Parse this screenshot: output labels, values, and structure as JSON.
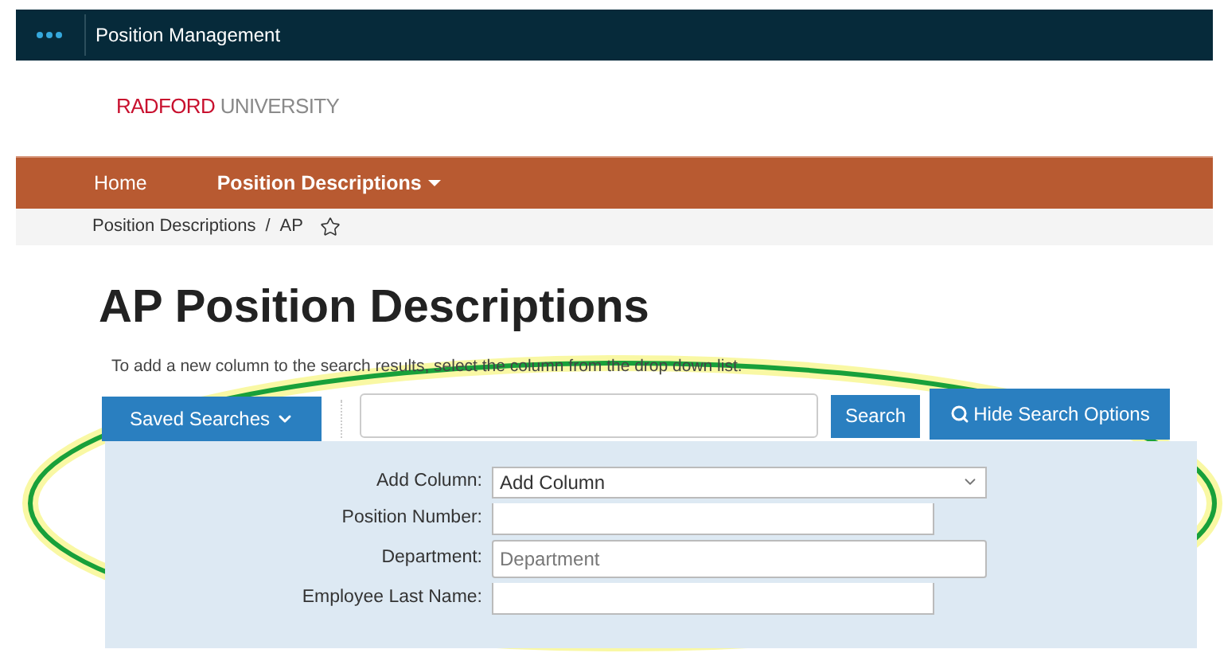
{
  "app_bar": {
    "title": "Position Management"
  },
  "logo": {
    "primary": "RADFORD",
    "secondary": "UNIVERSITY"
  },
  "nav": [
    {
      "label": "Home",
      "selected": false,
      "dropdown": false
    },
    {
      "label": "Position Descriptions",
      "selected": true,
      "dropdown": true
    }
  ],
  "breadcrumb": [
    "Position Descriptions",
    "AP"
  ],
  "breadcrumb_separator": "/",
  "page_title": "AP Position Descriptions",
  "instruction": "To add a new column to the search results, select the column from the drop down list.",
  "toolbar": {
    "saved_searches": "Saved Searches",
    "search_button": "Search",
    "hide_options": "Hide Search Options"
  },
  "form": [
    {
      "label": "Add Column:",
      "kind": "select",
      "value": "Add Column"
    },
    {
      "label": "Position Number:",
      "kind": "text"
    },
    {
      "label": "Department:",
      "kind": "wide",
      "placeholder": "Department"
    },
    {
      "label": "Employee Last Name:",
      "kind": "text"
    }
  ]
}
